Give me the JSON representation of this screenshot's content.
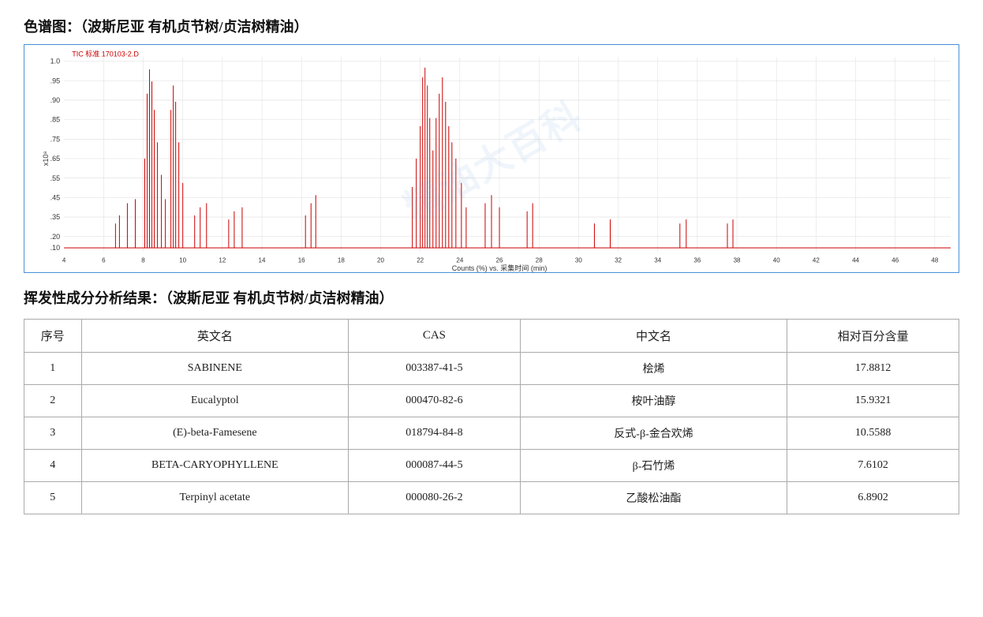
{
  "header": {
    "chart_title": "色谱图：（波斯尼亚 有机贞节树/贞洁树精油）",
    "results_title": "挥发性成分分析结果：（波斯尼亚 有机贞节树/贞洁树精油）"
  },
  "chart": {
    "label": "TIC 标准 170103-2.D",
    "x_label": "Counts (%) vs. 采集时间 (min)",
    "y_label": "x10⁸",
    "watermark": "精油大百科"
  },
  "table": {
    "columns": [
      "序号",
      "英文名",
      "CAS",
      "中文名",
      "相对百分含量"
    ],
    "rows": [
      {
        "seq": "1",
        "en": "SABINENE",
        "cas": "003387-41-5",
        "cn": "桧烯",
        "pct": "17.8812"
      },
      {
        "seq": "2",
        "en": "Eucalyptol",
        "cas": "000470-82-6",
        "cn": "桉叶油醇",
        "pct": "15.9321"
      },
      {
        "seq": "3",
        "en": "(E)-beta-Famesene",
        "cas": "018794-84-8",
        "cn": "反式-β-金合欢烯",
        "pct": "10.5588"
      },
      {
        "seq": "4",
        "en": "BETA-CARYOPHYLLENE",
        "cas": "000087-44-5",
        "cn": "β-石竹烯",
        "pct": "7.6102"
      },
      {
        "seq": "5",
        "en": "Terpinyl acetate",
        "cas": "000080-26-2",
        "cn": "乙酸松油酯",
        "pct": "6.8902"
      }
    ]
  }
}
